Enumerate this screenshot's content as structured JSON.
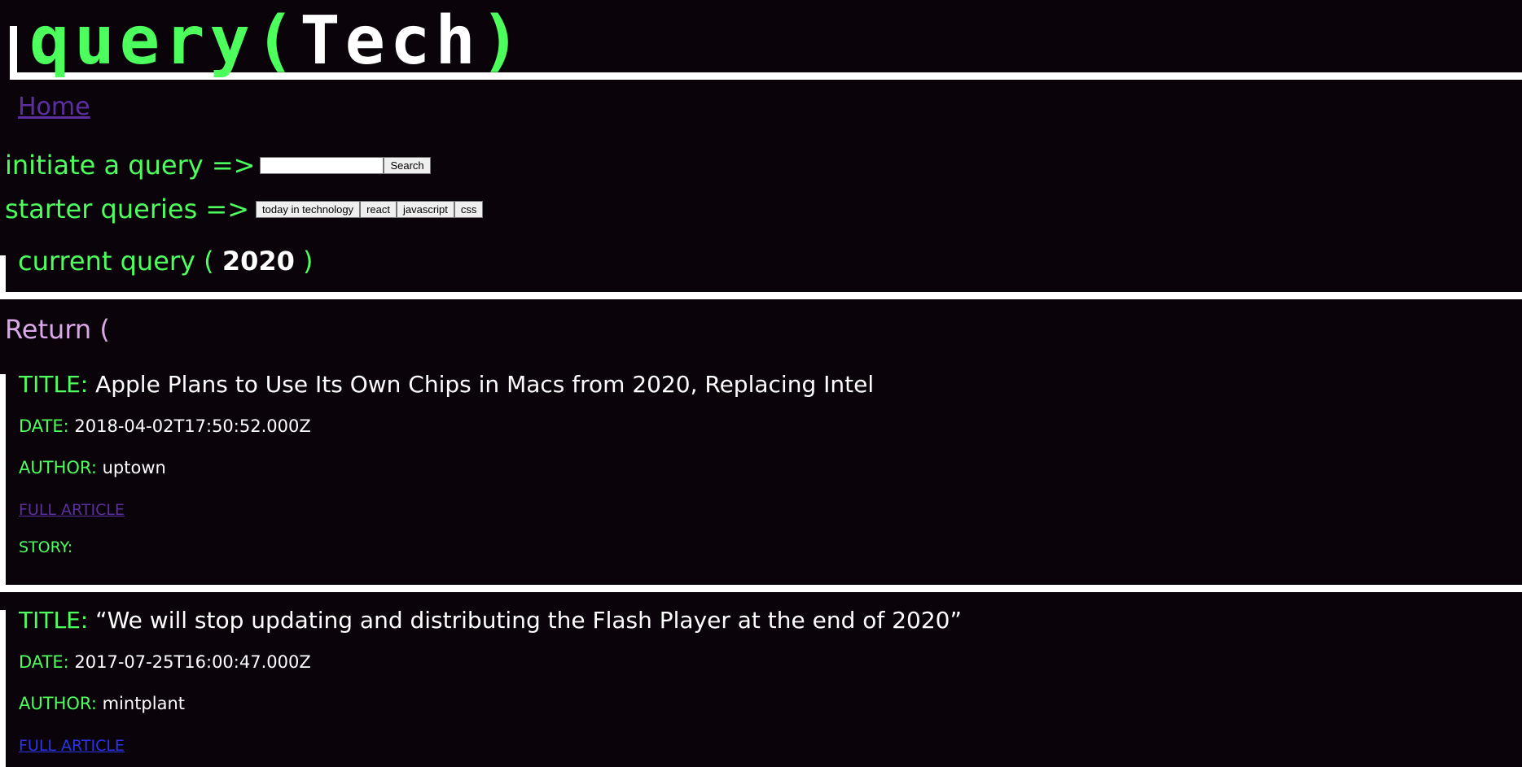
{
  "header": {
    "logo_prefix": "query",
    "logo_open": "(",
    "logo_word": "Tech",
    "logo_close": ")"
  },
  "nav": {
    "home_label": "Home"
  },
  "search": {
    "label": "initiate a query =>",
    "input_value": "",
    "button_label": "Search"
  },
  "starter": {
    "label": "starter queries =>",
    "buttons": [
      "today in technology",
      "react",
      "javascript",
      "css"
    ]
  },
  "current_query": {
    "label": "current query (",
    "value": "2020",
    "close": ")"
  },
  "results": {
    "return_label": "Return (",
    "field_labels": {
      "title": "TITLE:",
      "date": "DATE:",
      "author": "AUTHOR:",
      "link": "FULL ARTICLE",
      "story": "STORY:"
    },
    "articles": [
      {
        "title": "Apple Plans to Use Its Own Chips in Macs from 2020, Replacing Intel",
        "date": "2018-04-02T17:50:52.000Z",
        "author": "uptown",
        "story": ""
      },
      {
        "title": "“We will stop updating and distributing the Flash Player at the end of 2020”",
        "date": "2017-07-25T16:00:47.000Z",
        "author": "mintplant"
      }
    ]
  },
  "colors": {
    "background": "#0b030a",
    "accent_green": "#4dff5c",
    "white": "#ffffff",
    "visited_link": "#5b2f9e",
    "link": "#2b35e6",
    "return_pink": "#d8a8e8"
  }
}
